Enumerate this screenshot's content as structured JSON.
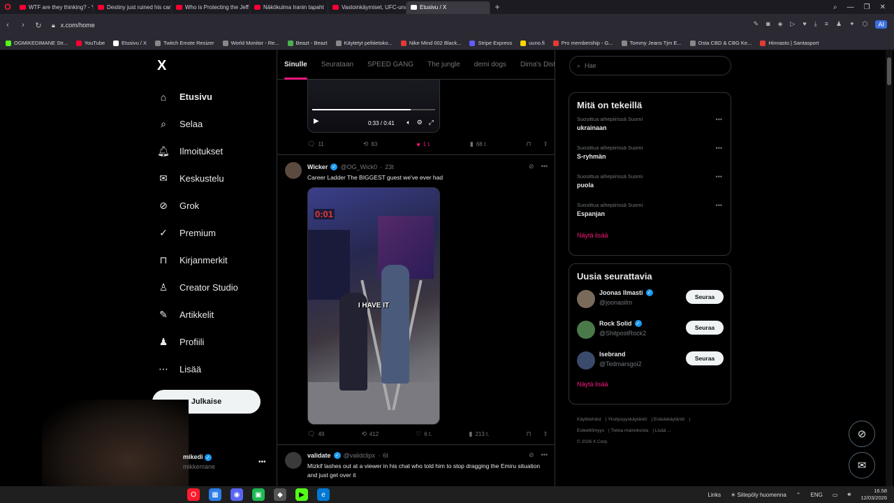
{
  "browser": {
    "tabs": [
      {
        "label": "WTF are they thinking? - Y"
      },
      {
        "label": "Destiny just ruined his car"
      },
      {
        "label": "Who is Protecting the Jeff"
      },
      {
        "label": "Näkökulma Iranin tapaht"
      },
      {
        "label": "Vastoinkäymiset, UFC-una"
      },
      {
        "label": "Etusivu / X"
      }
    ],
    "active_tab": "Etusivu / X",
    "url": "x.com/home",
    "ai_label": "AI",
    "bookmarks": [
      "OGMIKEDIMANE Str...",
      "YouTube",
      "Etusivu / X",
      "Twitch Emote Resizer",
      "World Monitor - Re...",
      "Beazt - Beazt",
      "Käytetyt pelitietoko...",
      "Nike Mind 002 Black...",
      "Stripe Express",
      "uuno.fi",
      "Pro membership - G...",
      "Tommy Jeans Tjm E...",
      "Osta CBD & CBG Ke...",
      "Hinnasto | Santasport"
    ]
  },
  "nav": {
    "logo": "X",
    "items": [
      {
        "label": "Etusivu",
        "icon": "home-icon",
        "glyph": "⌂"
      },
      {
        "label": "Selaa",
        "icon": "search-icon",
        "glyph": "⌕"
      },
      {
        "label": "Ilmoitukset",
        "icon": "bell-icon",
        "glyph": "🔔︎"
      },
      {
        "label": "Keskustelu",
        "icon": "mail-icon",
        "glyph": "✉"
      },
      {
        "label": "Grok",
        "icon": "grok-icon",
        "glyph": "⊘"
      },
      {
        "label": "Premium",
        "icon": "premium-icon",
        "glyph": "✓"
      },
      {
        "label": "Kirjanmerkit",
        "icon": "bookmark-icon",
        "glyph": "⊓"
      },
      {
        "label": "Creator Studio",
        "icon": "creator-studio-icon",
        "glyph": "♙"
      },
      {
        "label": "Artikkelit",
        "icon": "articles-icon",
        "glyph": "✎"
      },
      {
        "label": "Profiili",
        "icon": "profile-icon",
        "glyph": "♟"
      },
      {
        "label": "Lisää",
        "icon": "more-icon",
        "glyph": "⋯"
      }
    ],
    "post_button": "Julkaise",
    "account_name": "mikedi",
    "account_handle": "mikkemane"
  },
  "timeline": {
    "tabs": [
      "Sinulle",
      "Seurataan",
      "SPEED GANG",
      "The jungle",
      "demi dogs",
      "Dima's Dist"
    ],
    "video": {
      "time": "0:33 / 0:41"
    },
    "post0_actions": {
      "replies": "11",
      "reposts": "83",
      "likes": "1 t.",
      "views": "68 t."
    },
    "post1": {
      "name": "Wicker",
      "handle": "@OG_Wick0",
      "time": "23t",
      "text": "Career Ladder The BIGGEST guest we've ever had",
      "media_timer": "0:01",
      "media_caption": "I HAVE IT",
      "replies": "49",
      "reposts": "412",
      "likes": "6 t.",
      "views": "213 t."
    },
    "post2": {
      "name": "validate",
      "handle": "@validclipx",
      "time": "6t",
      "text": "Mizkif lashes out at a viewer in his chat who told him to stop dragging the Emiru situation and just get over it"
    }
  },
  "sidebar": {
    "search_placeholder": "Hae",
    "trends_title": "Mitä on tekeillä",
    "trends": [
      {
        "context": "Suosittua aihepiirissä Suomi",
        "title": "ukrainaan"
      },
      {
        "context": "Suosittua aihepiirissä Suomi",
        "title": "S-ryhmän"
      },
      {
        "context": "Suosittua aihepiirissä Suomi",
        "title": "puola"
      },
      {
        "context": "Suosittua aihepiirissä Suomi",
        "title": "Espanjan"
      }
    ],
    "show_more": "Näytä lisää",
    "follow_title": "Uusia seurattavia",
    "follow": [
      {
        "name": "Joonas Ilmasti",
        "handle": "@joonasilm",
        "button": "Seuraa"
      },
      {
        "name": "Rock Solid",
        "handle": "@ShitpostRock2",
        "button": "Seuraa"
      },
      {
        "name": "Isebrand",
        "handle": "@Tedmarsgoi2",
        "button": "Seuraa"
      }
    ],
    "footer": [
      "Käyttöehdot",
      "Yksityisyyskäytäntö",
      "Evästekäytäntö",
      "Esteettömyys",
      "Tietoa mainoksista",
      "Lisää ...",
      "© 2026 X Corp."
    ]
  },
  "taskbar": {
    "links": "Links",
    "weather": "Siitepöly huomenna",
    "lang": "ENG",
    "time": "16.58",
    "date": "12/03/2026"
  },
  "colors": {
    "accent": "#f91880",
    "verified": "#1d9bf0",
    "background": "#000000"
  }
}
